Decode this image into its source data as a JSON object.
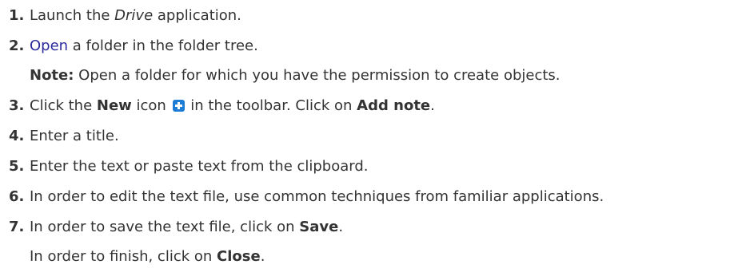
{
  "steps": [
    {
      "number": "1.",
      "before": "Launch the ",
      "app": "Drive",
      "after": " application."
    },
    {
      "number": "2.",
      "link": "Open",
      "after": " a folder in the folder tree.",
      "note_label": "Note:",
      "note_text": " Open a folder for which you have the permission to create objects."
    },
    {
      "number": "3.",
      "before": "Click the ",
      "bold1": "New",
      "mid": " icon",
      "icon": "plus-square-icon",
      "mid2": " in the toolbar. Click on ",
      "bold2": "Add note",
      "end": "."
    },
    {
      "number": "4.",
      "text": "Enter a title."
    },
    {
      "number": "5.",
      "text": "Enter the text or paste text from the clipboard."
    },
    {
      "number": "6.",
      "text": "In order to edit the text file, use common techniques from familiar applications."
    },
    {
      "number": "7.",
      "line1_before": "In order to save the text file, click on ",
      "line1_bold": "Save",
      "line1_end": ".",
      "line2_before": "In order to finish, click on ",
      "line2_bold": "Close",
      "line2_end": "."
    }
  ],
  "colors": {
    "text": "#333333",
    "link": "#2a2a9c",
    "icon": "#1d7cd6"
  }
}
